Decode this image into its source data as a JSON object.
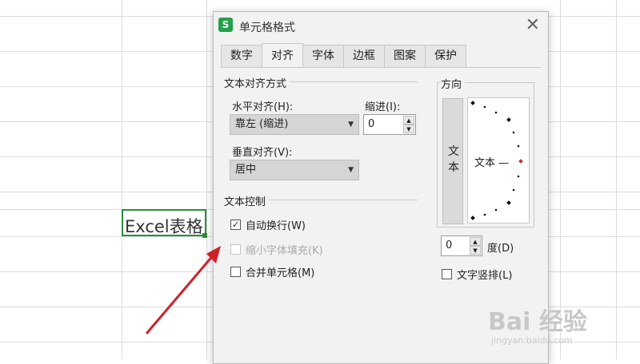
{
  "sheet": {
    "cell_text": "Excel表格"
  },
  "dialog": {
    "icon_letter": "S",
    "title": "单元格格式",
    "close_glyph": "✕",
    "tabs": [
      {
        "label": "数字",
        "active": false
      },
      {
        "label": "对齐",
        "active": true
      },
      {
        "label": "字体",
        "active": false
      },
      {
        "label": "边框",
        "active": false
      },
      {
        "label": "图案",
        "active": false
      },
      {
        "label": "保护",
        "active": false
      }
    ],
    "text_align": {
      "section_label": "文本对齐方式",
      "horizontal_label": "水平对齐(H):",
      "horizontal_value": "靠左 (缩进)",
      "indent_label": "缩进(I):",
      "indent_value": "0",
      "vertical_label": "垂直对齐(V):",
      "vertical_value": "居中"
    },
    "text_control": {
      "section_label": "文本控制",
      "wrap_label": "自动换行(W)",
      "wrap_checked": true,
      "shrink_label": "缩小字体填充(K)",
      "shrink_enabled": false,
      "merge_label": "合并单元格(M)",
      "merge_checked": false
    },
    "orientation": {
      "section_label": "方向",
      "vertical_text": "文本",
      "dial_text": "文本 —",
      "degree_value": "0",
      "degree_label": "度(D)",
      "vertical_text_label": "文字竖排(L)"
    },
    "colors": {
      "accent": "#2e8b3d",
      "arrow": "#d0202a",
      "dial_marker": "#c0392b"
    }
  },
  "watermark": {
    "brand": "Bai 经验",
    "url": "jingyan.baidu.com"
  }
}
